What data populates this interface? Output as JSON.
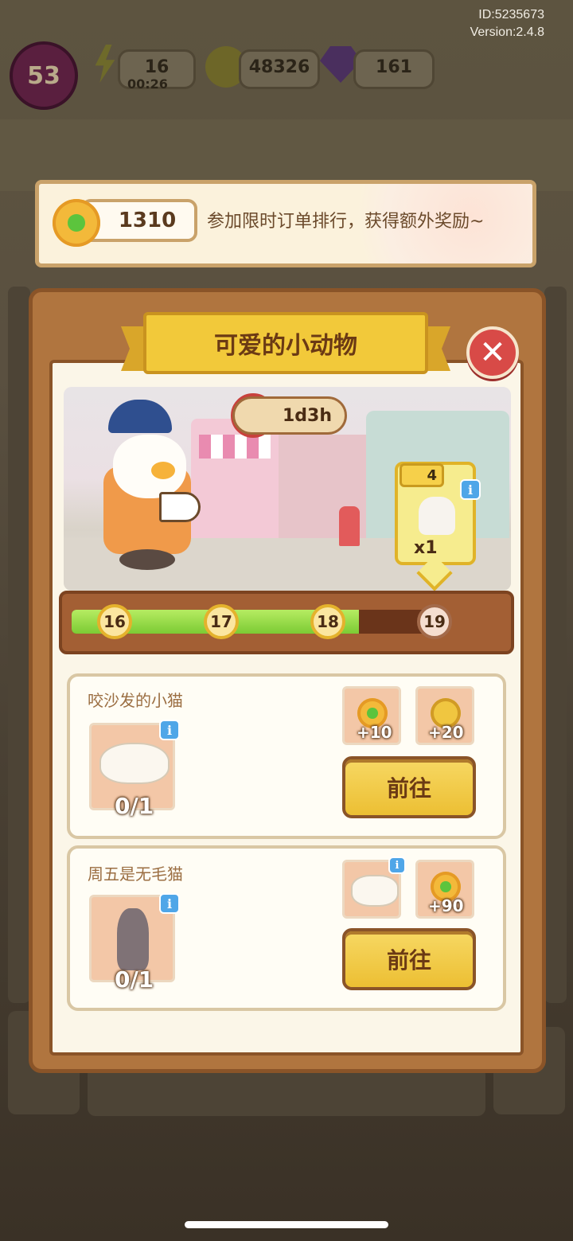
{
  "meta": {
    "id_label": "ID:5235673",
    "version_label": "Version:2.4.8"
  },
  "hud": {
    "level": "53",
    "energy": "16",
    "energy_timer": "00:26",
    "coins": "48326",
    "gems": "161"
  },
  "banner": {
    "score": "1310",
    "text": "参加限时订单排行，获得额外奖励~"
  },
  "modal": {
    "title": "可爱的小动物",
    "close_icon": "close-icon",
    "timer": "1d3h",
    "tag": {
      "count": "4",
      "quantity": "x1"
    },
    "progress": {
      "fraction": 0.81,
      "nodes": [
        "16",
        "17",
        "18",
        "19"
      ],
      "completed_nodes": 3
    },
    "tasks": [
      {
        "title": "咬沙发的小猫",
        "count": "0/1",
        "rewards": [
          {
            "icon": "flower-icon",
            "value": "+10"
          },
          {
            "icon": "coin-icon",
            "value": "+20"
          }
        ],
        "button": "前往"
      },
      {
        "title": "周五是无毛猫",
        "count": "0/1",
        "rewards": [
          {
            "icon": "cat-item-icon",
            "value": ""
          },
          {
            "icon": "flower-icon",
            "value": "+90"
          }
        ],
        "button": "前往"
      }
    ]
  },
  "colors": {
    "accent": "#f2c93a",
    "close": "#d84a47",
    "progress": "#8ed83f",
    "frame": "#b0753f"
  }
}
